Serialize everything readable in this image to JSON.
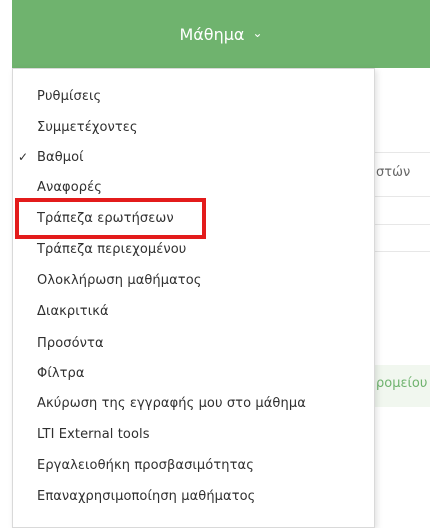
{
  "header": {
    "title": "Μάθημα",
    "chevron": "chevron-down-icon"
  },
  "background": {
    "col_text": "στών",
    "link_text": "ρομείου"
  },
  "menu": {
    "items": [
      {
        "label": "Ρυθμίσεις"
      },
      {
        "label": "Συμμετέχοντες"
      },
      {
        "label": "Βαθμοί",
        "checked": true
      },
      {
        "label": "Αναφορές"
      },
      {
        "label": "Τράπεζα ερωτήσεων",
        "highlighted": true
      },
      {
        "label": "Τράπεζα περιεχομένου"
      },
      {
        "label": "Ολοκλήρωση μαθήματος"
      },
      {
        "label": "Διακριτικά"
      },
      {
        "label": "Προσόντα"
      },
      {
        "label": "Φίλτρα"
      },
      {
        "label": "Ακύρωση της εγγραφής μου στο μάθημα"
      },
      {
        "label": "LTI External tools"
      },
      {
        "label": "Εργαλειοθήκη προσβασιμότητας"
      },
      {
        "label": "Επαναχρησιμοποίηση μαθήματος"
      }
    ]
  },
  "colors": {
    "header_green": "#6fb36e",
    "highlight_red": "#e31b1b"
  }
}
